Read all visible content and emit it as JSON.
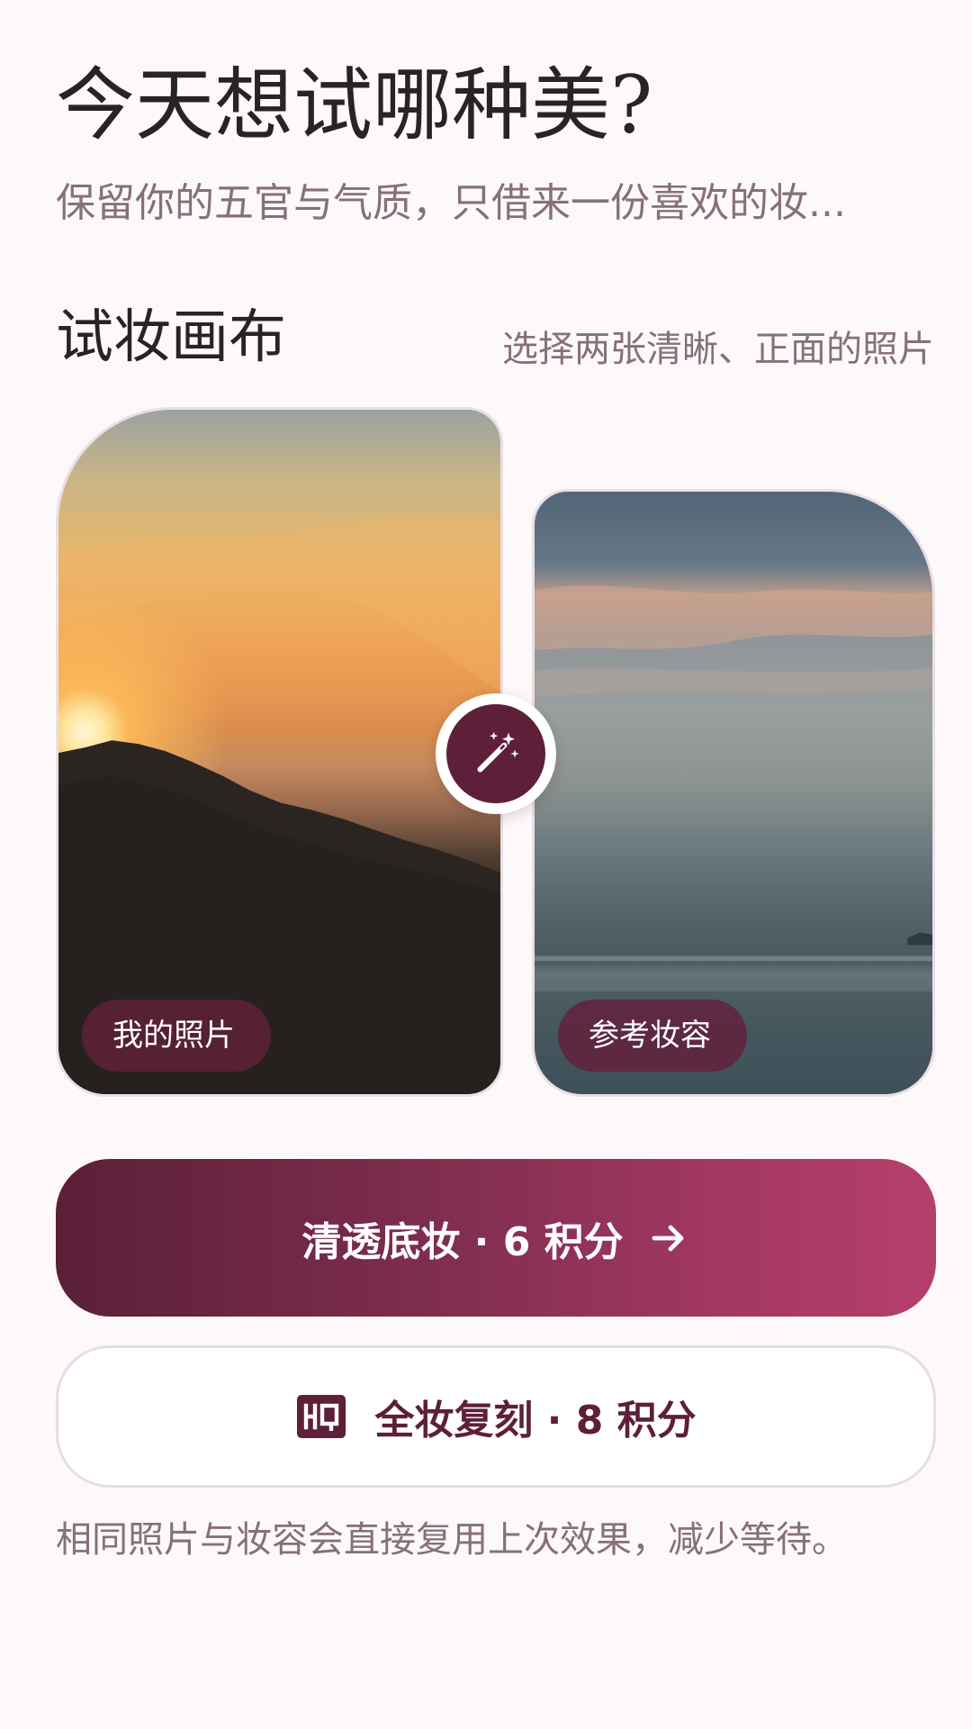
{
  "header": {
    "title": "今天想试哪种美?",
    "subtitle": "保留你的五官与气质，只借来一份喜欢的妆..."
  },
  "canvas": {
    "section_title": "试妆画布",
    "hint": "选择两张清晰、正面的照片",
    "my_photo_label": "我的照片",
    "reference_label": "参考妆容",
    "swap_icon": "magic-wand-icon"
  },
  "actions": {
    "primary_label": "清透底妆 · 6 积分",
    "primary_icon": "arrow-right-icon",
    "secondary_label": "全妆复刻 · 8 积分",
    "secondary_icon": "hq-icon"
  },
  "footer": {
    "note": "相同照片与妆容会直接复用上次效果，减少等待。"
  },
  "colors": {
    "background": "#fdf8f9",
    "accent": "#5e1f38",
    "accent_gradient_end": "#b63f6c",
    "muted_text": "#86707a"
  }
}
